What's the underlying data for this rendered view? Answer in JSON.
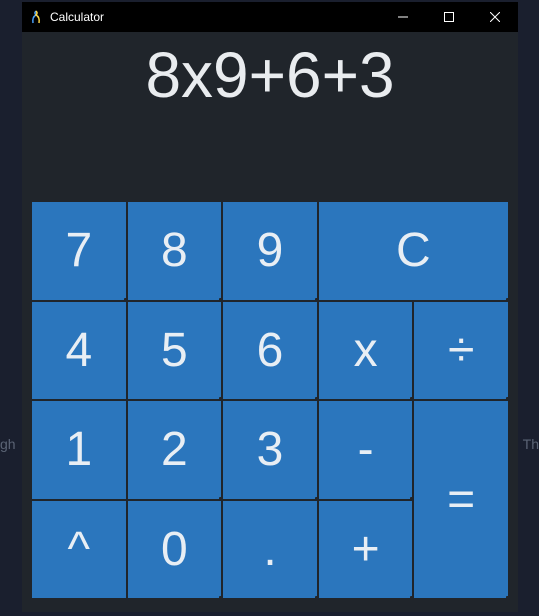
{
  "window": {
    "title": "Calculator"
  },
  "display": {
    "expression": "8x9+6+3"
  },
  "keys": {
    "r0c0": "7",
    "r0c1": "8",
    "r0c2": "9",
    "r0c3": "C",
    "r1c0": "4",
    "r1c1": "5",
    "r1c2": "6",
    "r1c3": "x",
    "r1c4": "÷",
    "r2c0": "1",
    "r2c1": "2",
    "r2c2": "3",
    "r2c3": "-",
    "r2c4": "=",
    "r3c0": "^",
    "r3c1": "0",
    "r3c2": ".",
    "r3c3": "+"
  },
  "bg": {
    "left": "gh",
    "right": "Th"
  }
}
